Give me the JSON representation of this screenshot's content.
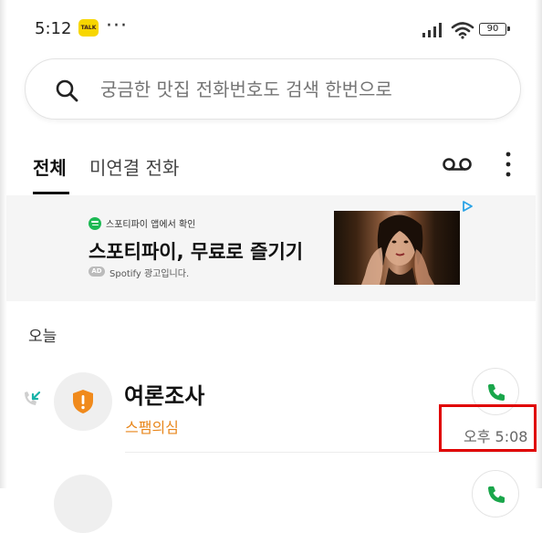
{
  "status_bar": {
    "time": "5:12",
    "kakao_icon_text": "TALK",
    "more_dots": "···",
    "battery": "90",
    "icons": [
      "kakaotalk-icon",
      "signal-icon",
      "wifi-icon",
      "battery-icon"
    ]
  },
  "search": {
    "placeholder": "궁금한 맛집 전화번호도 검색 한번으로",
    "icon": "search-icon"
  },
  "tabs": [
    {
      "label": "전체",
      "selected": true
    },
    {
      "label": "미연결 전화",
      "selected": false
    }
  ],
  "toolbar": {
    "icons": [
      "voicemail-icon",
      "more-vertical-icon"
    ]
  },
  "ad": {
    "sub": "스포티파이 앱에서 확인",
    "title": "스포티파이, 무료로 즐기기",
    "badge": "AD",
    "note": "Spotify 광고입니다."
  },
  "section_label": "오늘",
  "calls": [
    {
      "name": "여론조사",
      "tag": "스팸의심",
      "time": "오후 5:08",
      "direction_icon": "incoming-call-icon",
      "avatar_icon": "spam-shield-icon"
    }
  ],
  "colors": {
    "accent_orange": "#e8861b",
    "call_green": "#1aa64b",
    "incoming_teal": "#19b3a8",
    "highlight_red": "#e00000"
  }
}
